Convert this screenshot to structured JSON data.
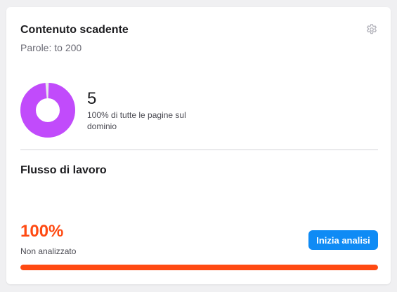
{
  "widget": {
    "title": "Contenuto scadente",
    "subtitle": "Parole: to 200",
    "settings_icon": "gear-icon"
  },
  "summary": {
    "count": "5",
    "description": "100% di tutte le pagine sul dominio",
    "donut_fraction": 0.99,
    "donut_color": "#c14bfb"
  },
  "workflow": {
    "title": "Flusso di lavoro",
    "percent": "100%",
    "status": "Non analizzato",
    "button_label": "Inizia analisi",
    "progress_fraction": 1.0,
    "progress_color": "#ff4a12",
    "button_color": "#0f8bf5"
  }
}
